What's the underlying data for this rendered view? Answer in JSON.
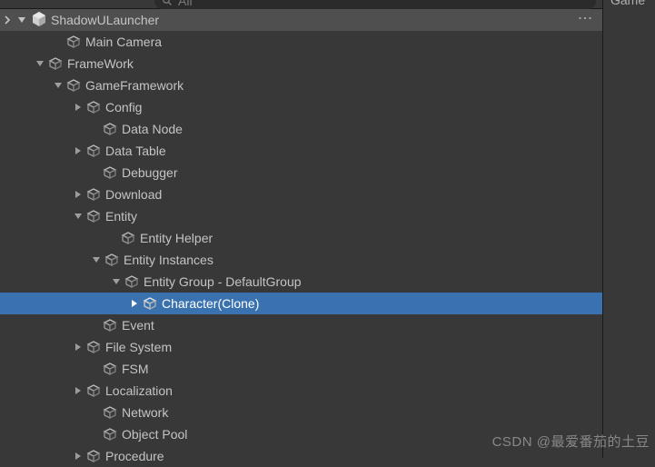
{
  "search": {
    "placeholder": "All"
  },
  "rightTab": "Game",
  "root": {
    "label": "ShadowULauncher"
  },
  "nodes": [
    {
      "indent": 58,
      "tog": "none",
      "label": "Main Camera"
    },
    {
      "indent": 38,
      "tog": "down",
      "label": "FrameWork"
    },
    {
      "indent": 58,
      "tog": "down",
      "label": "GameFramework"
    },
    {
      "indent": 80,
      "tog": "right",
      "label": "Config"
    },
    {
      "indent": 98,
      "tog": "none",
      "label": "Data Node"
    },
    {
      "indent": 80,
      "tog": "right",
      "label": "Data Table"
    },
    {
      "indent": 98,
      "tog": "none",
      "label": "Debugger"
    },
    {
      "indent": 80,
      "tog": "right",
      "label": "Download"
    },
    {
      "indent": 80,
      "tog": "down",
      "label": "Entity"
    },
    {
      "indent": 118,
      "tog": "none",
      "label": "Entity Helper"
    },
    {
      "indent": 100,
      "tog": "down",
      "label": "Entity Instances"
    },
    {
      "indent": 122,
      "tog": "down",
      "label": "Entity Group - DefaultGroup"
    },
    {
      "indent": 142,
      "tog": "right",
      "label": "Character(Clone)",
      "selected": true
    },
    {
      "indent": 98,
      "tog": "none",
      "label": "Event"
    },
    {
      "indent": 80,
      "tog": "right",
      "label": "File System"
    },
    {
      "indent": 98,
      "tog": "none",
      "label": "FSM"
    },
    {
      "indent": 80,
      "tog": "right",
      "label": "Localization"
    },
    {
      "indent": 98,
      "tog": "none",
      "label": "Network"
    },
    {
      "indent": 98,
      "tog": "none",
      "label": "Object Pool"
    },
    {
      "indent": 80,
      "tog": "right",
      "label": "Procedure"
    }
  ],
  "watermark": "CSDN @最爱番茄的土豆"
}
